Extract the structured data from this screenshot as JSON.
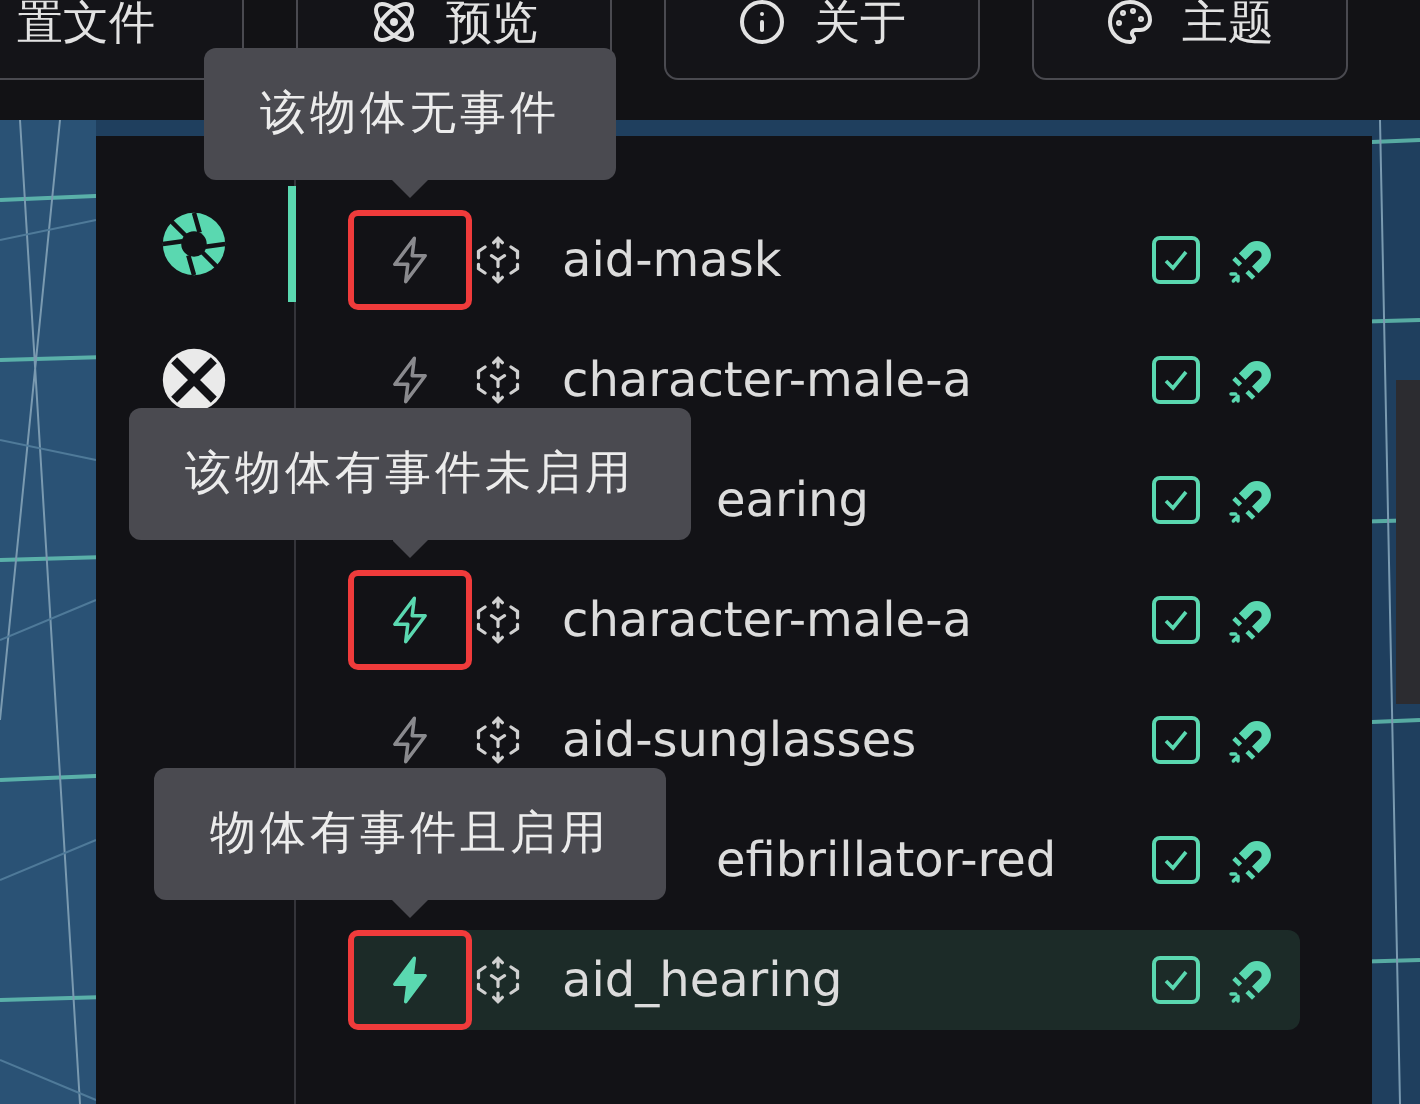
{
  "toolbar": {
    "buttons": [
      {
        "label": "置文件"
      },
      {
        "label": "预览"
      },
      {
        "label": "关于"
      },
      {
        "label": "主题"
      }
    ]
  },
  "nav": [
    {
      "selected": true
    },
    {
      "selected": false
    }
  ],
  "rows": [
    {
      "kind": "item",
      "has_events": false,
      "events_enabled": false,
      "name": "aid-mask",
      "checked": true,
      "selected": false,
      "highlighted": true,
      "tooltip": "该物体无事件"
    },
    {
      "kind": "item",
      "has_events": false,
      "events_enabled": false,
      "name": "character-male-a",
      "checked": true,
      "selected": false,
      "highlighted": false
    },
    {
      "kind": "covered",
      "name": "earing",
      "checked": true,
      "selected": false
    },
    {
      "kind": "item",
      "has_events": true,
      "events_enabled": false,
      "name": "character-male-a",
      "checked": true,
      "selected": false,
      "highlighted": true,
      "tooltip": "该物体有事件未启用"
    },
    {
      "kind": "item",
      "has_events": false,
      "events_enabled": false,
      "name": "aid-sunglasses",
      "checked": true,
      "selected": false,
      "highlighted": false
    },
    {
      "kind": "covered",
      "name": "efibrillator-red",
      "checked": true,
      "selected": false
    },
    {
      "kind": "item",
      "has_events": true,
      "events_enabled": true,
      "name": "aid_hearing",
      "checked": true,
      "selected": true,
      "highlighted": true,
      "tooltip": "物体有事件且启用"
    }
  ]
}
